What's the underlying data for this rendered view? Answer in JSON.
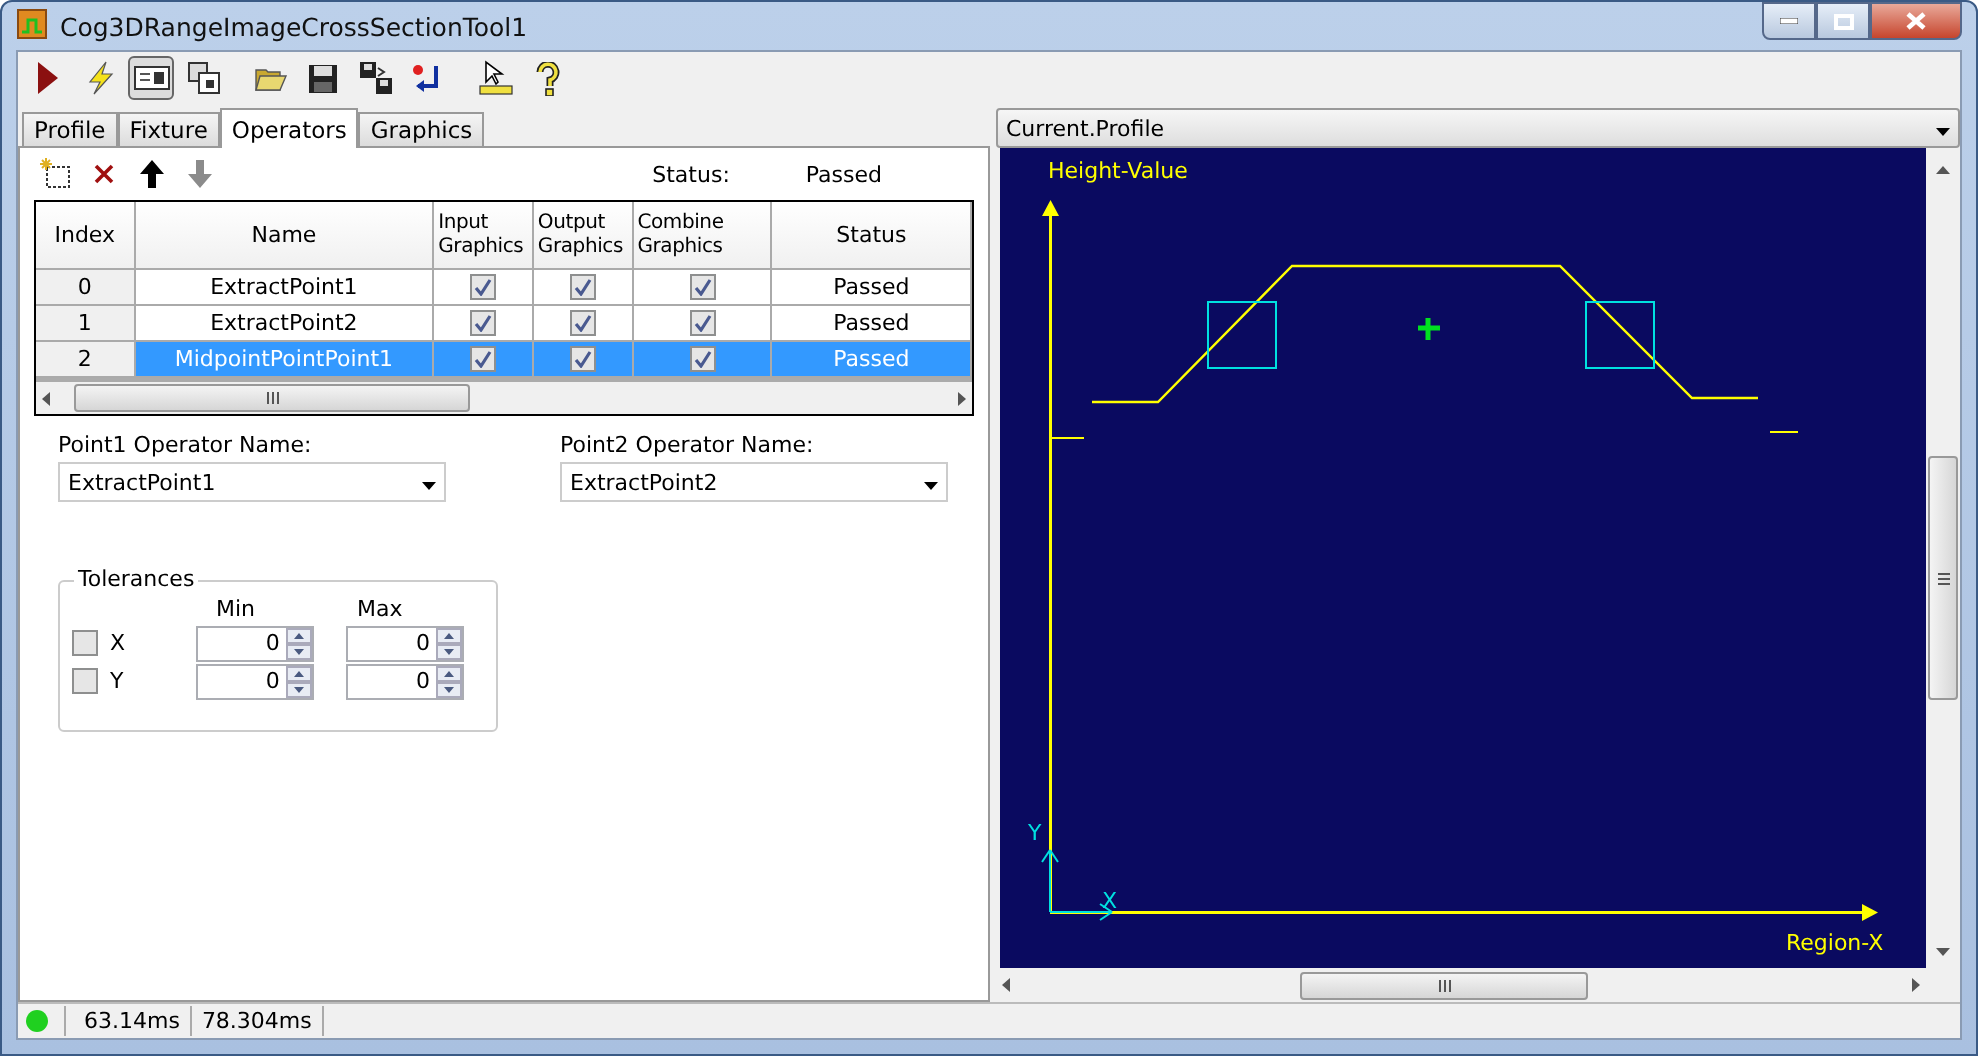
{
  "window": {
    "title": "Cog3DRangeImageCrossSectionTool1"
  },
  "toolbar": [
    {
      "kind": "run",
      "selected": false
    },
    {
      "kind": "flash",
      "selected": false
    },
    {
      "kind": "display",
      "selected": true
    },
    {
      "kind": "float",
      "selected": false
    },
    {
      "kind": "open",
      "selected": false
    },
    {
      "kind": "save",
      "selected": false
    },
    {
      "kind": "saveas",
      "selected": false
    },
    {
      "kind": "reset",
      "selected": false
    },
    {
      "kind": "ruler",
      "selected": false
    },
    {
      "kind": "help",
      "selected": false
    }
  ],
  "tabs": [
    {
      "label": "Profile",
      "selected": false
    },
    {
      "label": "Fixture",
      "selected": false
    },
    {
      "label": "Operators",
      "selected": true
    },
    {
      "label": "Graphics",
      "selected": false
    }
  ],
  "operators": {
    "tools": [
      {
        "kind": "new",
        "disabled": false
      },
      {
        "kind": "delete",
        "disabled": false
      },
      {
        "kind": "up",
        "disabled": false
      },
      {
        "kind": "down",
        "disabled": true
      }
    ],
    "status_label": "Status:",
    "status_value": "Passed",
    "columns": [
      "Index",
      "Name",
      "Input Graphics",
      "Output Graphics",
      "Combine Graphics",
      "Status"
    ],
    "rows": [
      {
        "index": "0",
        "name": "ExtractPoint1",
        "input_graphics": true,
        "output_graphics": true,
        "combine_graphics": true,
        "status": "Passed",
        "selected": false
      },
      {
        "index": "1",
        "name": "ExtractPoint2",
        "input_graphics": true,
        "output_graphics": true,
        "combine_graphics": true,
        "status": "Passed",
        "selected": false
      },
      {
        "index": "2",
        "name": "MidpointPointPoint1",
        "input_graphics": true,
        "output_graphics": true,
        "combine_graphics": true,
        "status": "Passed",
        "selected": true
      }
    ]
  },
  "point1": {
    "label": "Point1 Operator Name:",
    "value": "ExtractPoint1"
  },
  "point2": {
    "label": "Point2 Operator Name:",
    "value": "ExtractPoint2"
  },
  "tolerances": {
    "title": "Tolerances",
    "min_label": "Min",
    "max_label": "Max",
    "rows": [
      {
        "label": "X",
        "checked": false,
        "min": "0",
        "max": "0"
      },
      {
        "label": "Y",
        "checked": false,
        "min": "0",
        "max": "0"
      }
    ]
  },
  "display": {
    "selector": "Current.Profile",
    "y_axis_label": "Height-Value",
    "x_axis_label": "Region-X",
    "origin_x_label": "X",
    "origin_y_label": "Y"
  },
  "status_bar": {
    "ok": true,
    "times": [
      "63.14ms",
      "78.304ms"
    ]
  }
}
